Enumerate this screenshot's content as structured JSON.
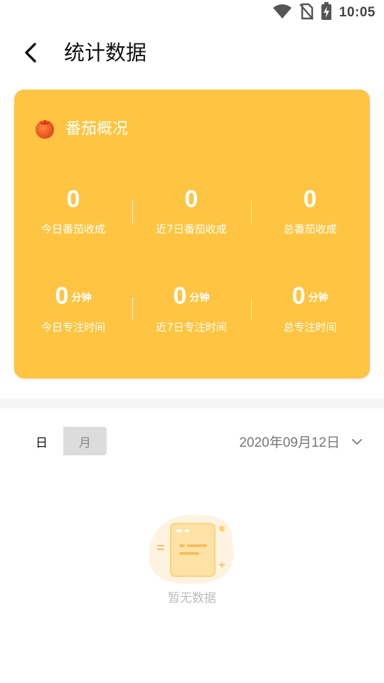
{
  "status_bar": {
    "time": "10:05",
    "icons": [
      "wifi-icon",
      "no-sim-icon",
      "battery-charging-icon"
    ]
  },
  "app_bar": {
    "back_icon": "back-arrow-icon",
    "title": "统计数据"
  },
  "overview": {
    "title": "番茄概况",
    "icon": "tomato-icon",
    "color": "#FFC542",
    "stats": [
      {
        "value": "0",
        "unit": "",
        "label": "今日番茄收成"
      },
      {
        "value": "0",
        "unit": "",
        "label": "近7日番茄收成"
      },
      {
        "value": "0",
        "unit": "",
        "label": "总番茄收成"
      },
      {
        "value": "0",
        "unit": "分钟",
        "label": "今日专注时间"
      },
      {
        "value": "0",
        "unit": "分钟",
        "label": "近7日专注时间"
      },
      {
        "value": "0",
        "unit": "分钟",
        "label": "总专注时间"
      }
    ]
  },
  "period_toggle": {
    "options": [
      "日",
      "月"
    ],
    "selected": "日"
  },
  "date_selector": {
    "value": "2020年09月12日",
    "icon": "chevron-down-icon"
  },
  "empty_state": {
    "icon": "empty-document-icon",
    "text": "暂无数据"
  }
}
